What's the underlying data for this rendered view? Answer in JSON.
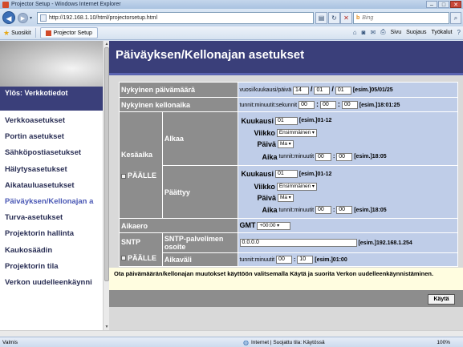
{
  "window": {
    "title": "Projector Setup - Windows Internet Explorer"
  },
  "nav": {
    "url": "http://192.168.1.10/html/projectorsetup.html",
    "search_placeholder": "Bing"
  },
  "favbar": {
    "favorites": "Suosikit",
    "tab": "Projector Setup",
    "cmd_page": "Sivu",
    "cmd_safety": "Suojaus",
    "cmd_tools": "Työkalut"
  },
  "sidebar": {
    "home": "Ylös: Verkkotiedot",
    "items": [
      "Verkkoasetukset",
      "Portin asetukset",
      "Sähköpostiasetukset",
      "Hälytysasetukset",
      "Aikatauluasetukset",
      "Päiväyksen/Kellonajan a",
      "Turva-asetukset",
      "Projektorin hallinta",
      "Kaukosäädin",
      "Projektorin tila",
      "Verkon uudelleenkäynni"
    ]
  },
  "main": {
    "title": "Päiväyksen/Kellonajan asetukset",
    "date": {
      "label": "Nykyinen päivämäärä",
      "fmt": "vuosi/kuukausi/päivä",
      "year": "14",
      "month": "01",
      "day": "01",
      "example": "[esim.]05/01/25"
    },
    "time": {
      "label": "Nykyinen kellonaika",
      "fmt": "tunnit:minuutit:sekunnit",
      "h": "00",
      "m": "00",
      "s": "00",
      "example": "[esim.]18:01:25"
    },
    "dst": {
      "label": "Kesäaika",
      "enable": "PÄÄLLE",
      "start": {
        "label": "Alkaa",
        "month_label": "Kuukausi",
        "month": "01",
        "month_ex": "[esim.]01-12",
        "week_label": "Viikko",
        "week": "Ensimmäinen",
        "day_label": "Päivä",
        "day": "Ma",
        "time_label": "Aika",
        "time_fmt": "tunnit:minuutit",
        "h": "00",
        "m": "00",
        "time_ex": "[esim.]18:05"
      },
      "end": {
        "label": "Päättyy",
        "month_label": "Kuukausi",
        "month": "01",
        "month_ex": "[esim.]01-12",
        "week_label": "Viikko",
        "week": "Ensimmäinen",
        "day_label": "Päivä",
        "day": "Ma",
        "time_label": "Aika",
        "time_fmt": "tunnit:minuutit",
        "h": "00",
        "m": "00",
        "time_ex": "[esim.]18:05"
      }
    },
    "tz": {
      "label": "Aikaero",
      "gmt": "GMT",
      "value": "+00:00"
    },
    "sntp": {
      "label": "SNTP",
      "enable": "PÄÄLLE",
      "server_label": "SNTP-palvelimen osoite",
      "server": "0.0.0.0",
      "server_ex": "[esim.]192.168.1.254",
      "interval_label": "Aikaväli",
      "interval_fmt": "tunnit:minuutit",
      "h": "00",
      "m": "10",
      "interval_ex": "[esim.]01:00"
    },
    "note": "Ota päivämäärän/kellonajan muutokset käyttöön valitsemalla Käytä ja suorita Verkon uudelleenkäynnistäminen.",
    "apply": "Käytä"
  },
  "status": {
    "left": "Valmis",
    "zone": "Internet | Suojattu tila: Käytössä",
    "zoom": "100%"
  }
}
